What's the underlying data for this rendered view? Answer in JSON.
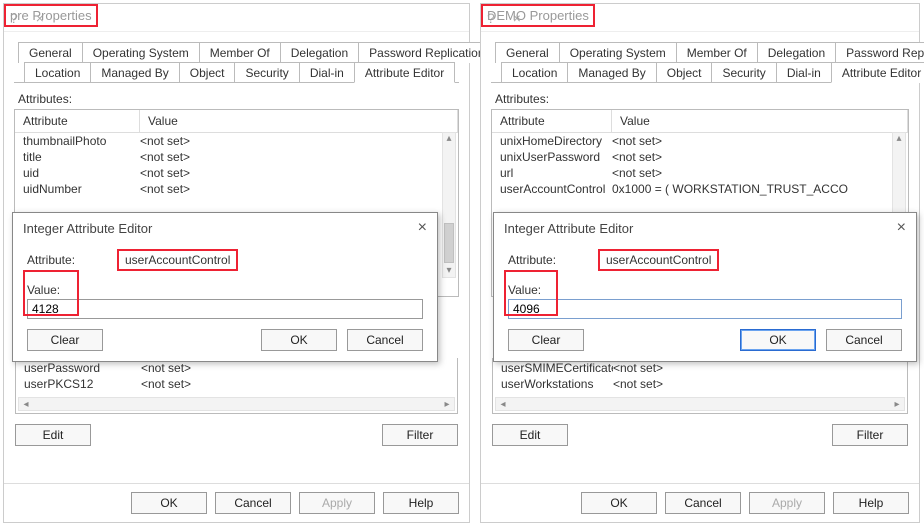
{
  "left": {
    "title": "pre Properties",
    "tabs_top": [
      "General",
      "Operating System",
      "Member Of",
      "Delegation",
      "Password Replication"
    ],
    "tabs_bottom": [
      "Location",
      "Managed By",
      "Object",
      "Security",
      "Dial-in",
      "Attribute Editor"
    ],
    "active_tab": "Attribute Editor",
    "attributes_label": "Attributes:",
    "header_a": "Attribute",
    "header_b": "Value",
    "rows_top": [
      {
        "attr": "thumbnailPhoto",
        "val": "<not set>"
      },
      {
        "attr": "title",
        "val": "<not set>"
      },
      {
        "attr": "uid",
        "val": "<not set>"
      },
      {
        "attr": "uidNumber",
        "val": "<not set>"
      }
    ],
    "rows_bottom": [
      {
        "attr": "userPassword",
        "val": "<not set>"
      },
      {
        "attr": "userPKCS12",
        "val": "<not set>"
      }
    ],
    "edit_label": "Edit",
    "filter_label": "Filter",
    "modal": {
      "title": "Integer Attribute Editor",
      "attribute_label": "Attribute:",
      "attribute_name": "userAccountControl",
      "value_label": "Value:",
      "value": "4128",
      "clear": "Clear",
      "ok": "OK",
      "cancel": "Cancel"
    },
    "footer": {
      "ok": "OK",
      "cancel": "Cancel",
      "apply": "Apply",
      "help": "Help"
    }
  },
  "right": {
    "title": "DEMO Properties",
    "tabs_top": [
      "General",
      "Operating System",
      "Member Of",
      "Delegation",
      "Password Replication"
    ],
    "tabs_bottom": [
      "Location",
      "Managed By",
      "Object",
      "Security",
      "Dial-in",
      "Attribute Editor"
    ],
    "active_tab": "Attribute Editor",
    "attributes_label": "Attributes:",
    "header_a": "Attribute",
    "header_b": "Value",
    "rows_top": [
      {
        "attr": "unixHomeDirectory",
        "val": "<not set>"
      },
      {
        "attr": "unixUserPassword",
        "val": "<not set>"
      },
      {
        "attr": "url",
        "val": "<not set>"
      },
      {
        "attr": "userAccountControl",
        "val": "0x1000 = ( WORKSTATION_TRUST_ACCO"
      }
    ],
    "rows_bottom": [
      {
        "attr": "userSMIMECertificate",
        "val": "<not set>"
      },
      {
        "attr": "userWorkstations",
        "val": "<not set>"
      }
    ],
    "edit_label": "Edit",
    "filter_label": "Filter",
    "modal": {
      "title": "Integer Attribute Editor",
      "attribute_label": "Attribute:",
      "attribute_name": "userAccountControl",
      "value_label": "Value:",
      "value": "4096",
      "clear": "Clear",
      "ok": "OK",
      "cancel": "Cancel"
    },
    "footer": {
      "ok": "OK",
      "cancel": "Cancel",
      "apply": "Apply",
      "help": "Help"
    }
  }
}
